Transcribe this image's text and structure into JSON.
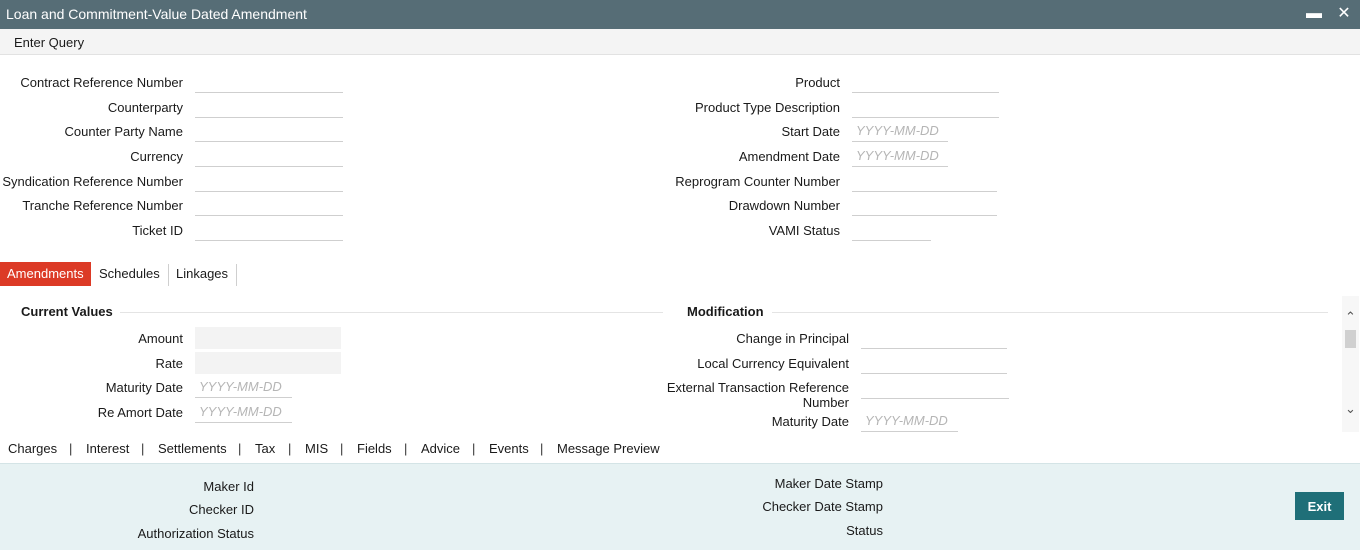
{
  "window": {
    "title": "Loan and Commitment-Value Dated Amendment",
    "minimize_glyph": "▬",
    "close_glyph": "✕"
  },
  "toolbar": {
    "enter_query": "Enter Query"
  },
  "header": {
    "contract_reference_number": "Contract Reference Number",
    "counterparty": "Counterparty",
    "counter_party_name": "Counter Party Name",
    "currency": "Currency",
    "syndication_reference_number": "Syndication Reference Number",
    "tranche_reference_number": "Tranche Reference Number",
    "ticket_id": "Ticket ID",
    "product": "Product",
    "product_type_description": "Product Type Description",
    "start_date": "Start Date",
    "amendment_date": "Amendment Date",
    "reprogram_counter_number": "Reprogram Counter Number",
    "drawdown_number": "Drawdown Number",
    "vami_status": "VAMI Status",
    "date_placeholder": "YYYY-MM-DD"
  },
  "tabs": [
    {
      "label": "Amendments",
      "active": true
    },
    {
      "label": "Schedules",
      "active": false
    },
    {
      "label": "Linkages",
      "active": false
    }
  ],
  "current_values": {
    "heading": "Current Values",
    "amount": "Amount",
    "rate": "Rate",
    "maturity_date": "Maturity Date",
    "re_amort_date": "Re Amort Date"
  },
  "modification": {
    "heading": "Modification",
    "change_in_principal": "Change in Principal",
    "local_currency_equivalent": "Local Currency Equivalent",
    "external_transaction_reference_number_line1": "External Transaction Reference",
    "external_transaction_reference_number_line2": "Number",
    "maturity_date": "Maturity Date"
  },
  "scrollbar": {
    "up_glyph": "⌃",
    "down_glyph": "⌄"
  },
  "subnav": {
    "items": [
      "Charges",
      "Interest",
      "Settlements",
      "Tax",
      "MIS",
      "Fields",
      "Advice",
      "Events",
      "Message Preview"
    ],
    "separator": "|"
  },
  "footer": {
    "maker_id": "Maker Id",
    "checker_id": "Checker ID",
    "authorization_status": "Authorization Status",
    "maker_date_stamp": "Maker Date Stamp",
    "checker_date_stamp": "Checker Date Stamp",
    "status": "Status",
    "exit": "Exit"
  },
  "colors": {
    "titlebar": "#566d76",
    "active_tab": "#dc3a26",
    "footer_bg": "#e7f2f3",
    "exit_button": "#1f6f78"
  }
}
